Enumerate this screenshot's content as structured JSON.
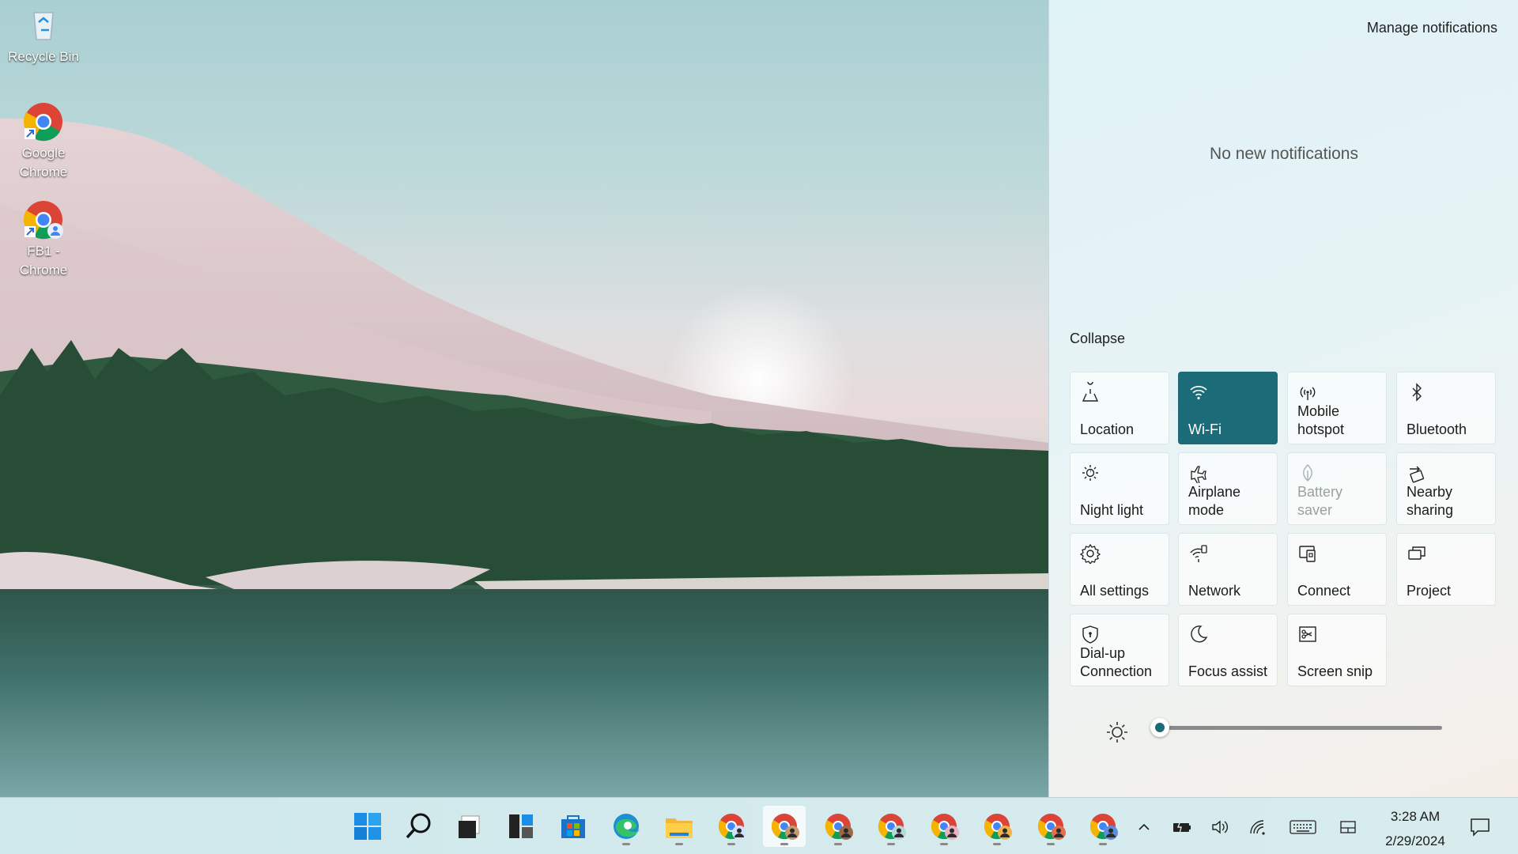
{
  "desktop": {
    "icons": [
      {
        "label": "Recycle Bin"
      },
      {
        "label": "Google Chrome"
      },
      {
        "label": "FB1 - Chrome"
      }
    ]
  },
  "notifications": {
    "manage_label": "Manage notifications",
    "empty_text": "No new notifications",
    "collapse_label": "Collapse"
  },
  "quick_actions": {
    "tiles": [
      {
        "label": "Location",
        "icon": "location-icon",
        "state": "normal"
      },
      {
        "label": "Wi-Fi",
        "icon": "wifi-icon",
        "state": "on"
      },
      {
        "label": "Mobile hotspot",
        "icon": "mobile-hotspot-icon",
        "state": "normal"
      },
      {
        "label": "Bluetooth",
        "icon": "bluetooth-icon",
        "state": "normal"
      },
      {
        "label": "Night light",
        "icon": "night-light-icon",
        "state": "normal"
      },
      {
        "label": "Airplane mode",
        "icon": "airplane-icon",
        "state": "normal"
      },
      {
        "label": "Battery saver",
        "icon": "battery-saver-icon",
        "state": "disabled"
      },
      {
        "label": "Nearby sharing",
        "icon": "nearby-sharing-icon",
        "state": "normal"
      },
      {
        "label": "All settings",
        "icon": "gear-icon",
        "state": "normal"
      },
      {
        "label": "Network",
        "icon": "network-icon",
        "state": "normal"
      },
      {
        "label": "Connect",
        "icon": "connect-icon",
        "state": "normal"
      },
      {
        "label": "Project",
        "icon": "project-icon",
        "state": "normal"
      },
      {
        "label": "Dial-up Connection",
        "icon": "dialup-icon",
        "state": "normal"
      },
      {
        "label": "Focus assist",
        "icon": "moon-icon",
        "state": "normal"
      },
      {
        "label": "Screen snip",
        "icon": "screen-snip-icon",
        "state": "normal"
      }
    ],
    "brightness_level": 0.03
  },
  "taskbar": {
    "apps": [
      "start-icon",
      "search-icon",
      "task-view-icon",
      "widgets-icon",
      "store-icon",
      "edge-icon",
      "file-explorer-icon",
      "chrome-profile-1-icon",
      "chrome-profile-2-icon",
      "chrome-profile-3-icon",
      "chrome-profile-4-icon",
      "chrome-profile-5-icon",
      "chrome-profile-6-icon",
      "chrome-profile-7-icon",
      "chrome-profile-8-icon"
    ],
    "clock": {
      "time": "3:28 AM",
      "date": "2/29/2024"
    }
  },
  "colors": {
    "accent": "#1b6b78"
  }
}
